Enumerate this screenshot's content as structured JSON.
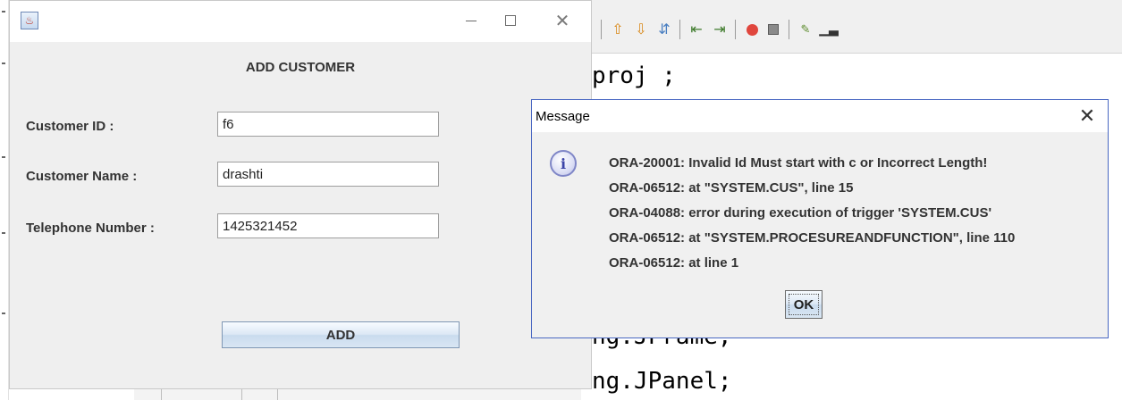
{
  "ide": {
    "code_lines": [
      "proj ;",
      "ng.JFrame;",
      "ng.JPanel;"
    ],
    "toolbar_icons": [
      "up-arrow-icon",
      "down-arrow-icon",
      "toggle-icon",
      "shift-left-icon",
      "shift-right-icon",
      "record-icon",
      "stop-icon",
      "macro-icon",
      "column-icon"
    ]
  },
  "frame": {
    "title": "",
    "heading": "ADD CUSTOMER",
    "fields": [
      {
        "label": "Customer ID :",
        "value": "f6"
      },
      {
        "label": "Customer Name :",
        "value": "drashti"
      },
      {
        "label": "Telephone Number :",
        "value": "1425321452"
      }
    ],
    "add_label": "ADD",
    "controls": {
      "minimize": "—",
      "maximize": "☐",
      "close": "✕"
    }
  },
  "dialog": {
    "title": "Message",
    "close": "✕",
    "icon": "i",
    "lines": [
      "ORA-20001: Invalid Id Must start with c or Incorrect Length!",
      "ORA-06512: at \"SYSTEM.CUS\", line 15",
      "ORA-04088: error during execution of trigger 'SYSTEM.CUS'",
      "ORA-06512: at \"SYSTEM.PROCESUREANDFUNCTION\", line 110",
      "ORA-06512: at line 1"
    ],
    "ok_label": "OK"
  },
  "colors": {
    "dialog_border": "#4a68c2",
    "record": "#e0463d"
  }
}
